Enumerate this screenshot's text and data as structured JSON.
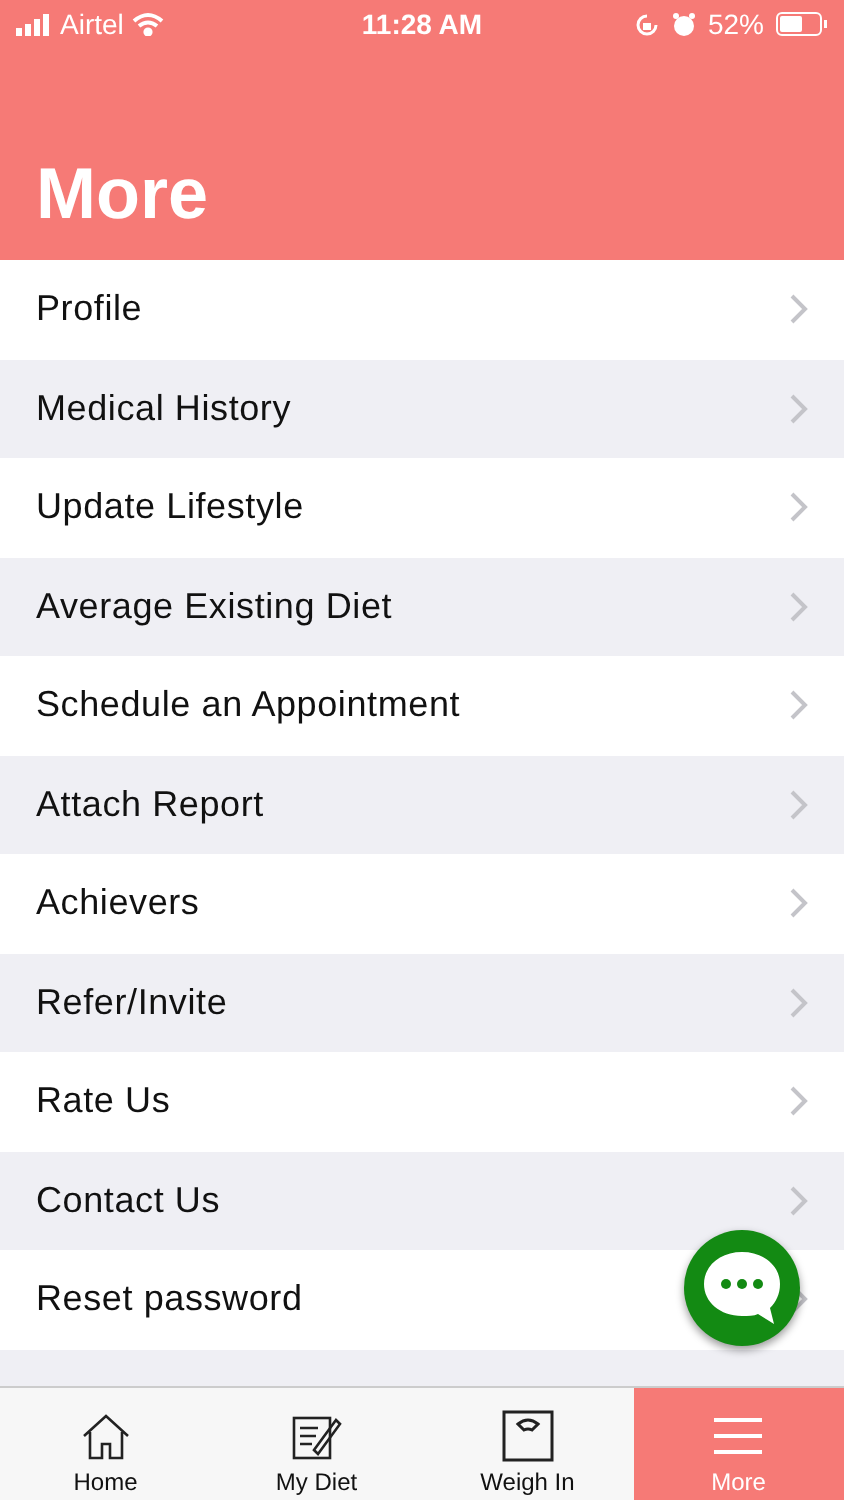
{
  "status_bar": {
    "carrier": "Airtel",
    "time": "11:28 AM",
    "battery": "52%"
  },
  "header": {
    "title": "More"
  },
  "menu": [
    {
      "label": "Profile"
    },
    {
      "label": "Medical History"
    },
    {
      "label": "Update Lifestyle"
    },
    {
      "label": "Average Existing Diet"
    },
    {
      "label": "Schedule an Appointment"
    },
    {
      "label": "Attach Report"
    },
    {
      "label": "Achievers"
    },
    {
      "label": "Refer/Invite"
    },
    {
      "label": "Rate Us"
    },
    {
      "label": "Contact Us"
    },
    {
      "label": "Reset password"
    }
  ],
  "tabs": [
    {
      "label": "Home",
      "kind": "home",
      "selected": false
    },
    {
      "label": "My Diet",
      "kind": "diet",
      "selected": false
    },
    {
      "label": "Weigh In",
      "kind": "scale",
      "selected": false
    },
    {
      "label": "More",
      "kind": "menu",
      "selected": true
    }
  ]
}
